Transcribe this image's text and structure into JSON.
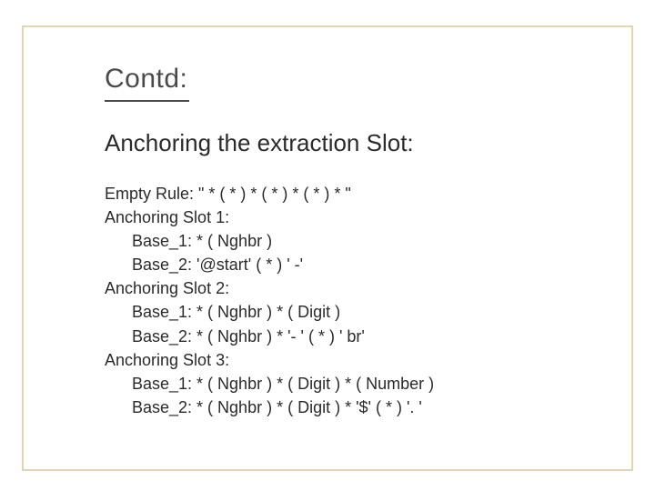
{
  "title": "Contd:",
  "subtitle": "Anchoring the extraction Slot:",
  "body": {
    "l1": "Empty Rule: \" * ( * ) * ( * ) * ( * ) * \"",
    "l2": "Anchoring Slot 1:",
    "l3": "Base_1: * ( Nghbr )",
    "l4": "Base_2: '@start' ( * ) ' -'",
    "l5": "Anchoring Slot 2:",
    "l6": "Base_1: * ( Nghbr ) * ( Digit )",
    "l7": "Base_2: * ( Nghbr ) * '- ' ( * ) ' br'",
    "l8": "Anchoring Slot 3:",
    "l9": "Base_1: * ( Nghbr ) * ( Digit ) * ( Number )",
    "l10": "Base_2: * ( Nghbr ) * ( Digit ) * '$' ( * ) '. '"
  }
}
